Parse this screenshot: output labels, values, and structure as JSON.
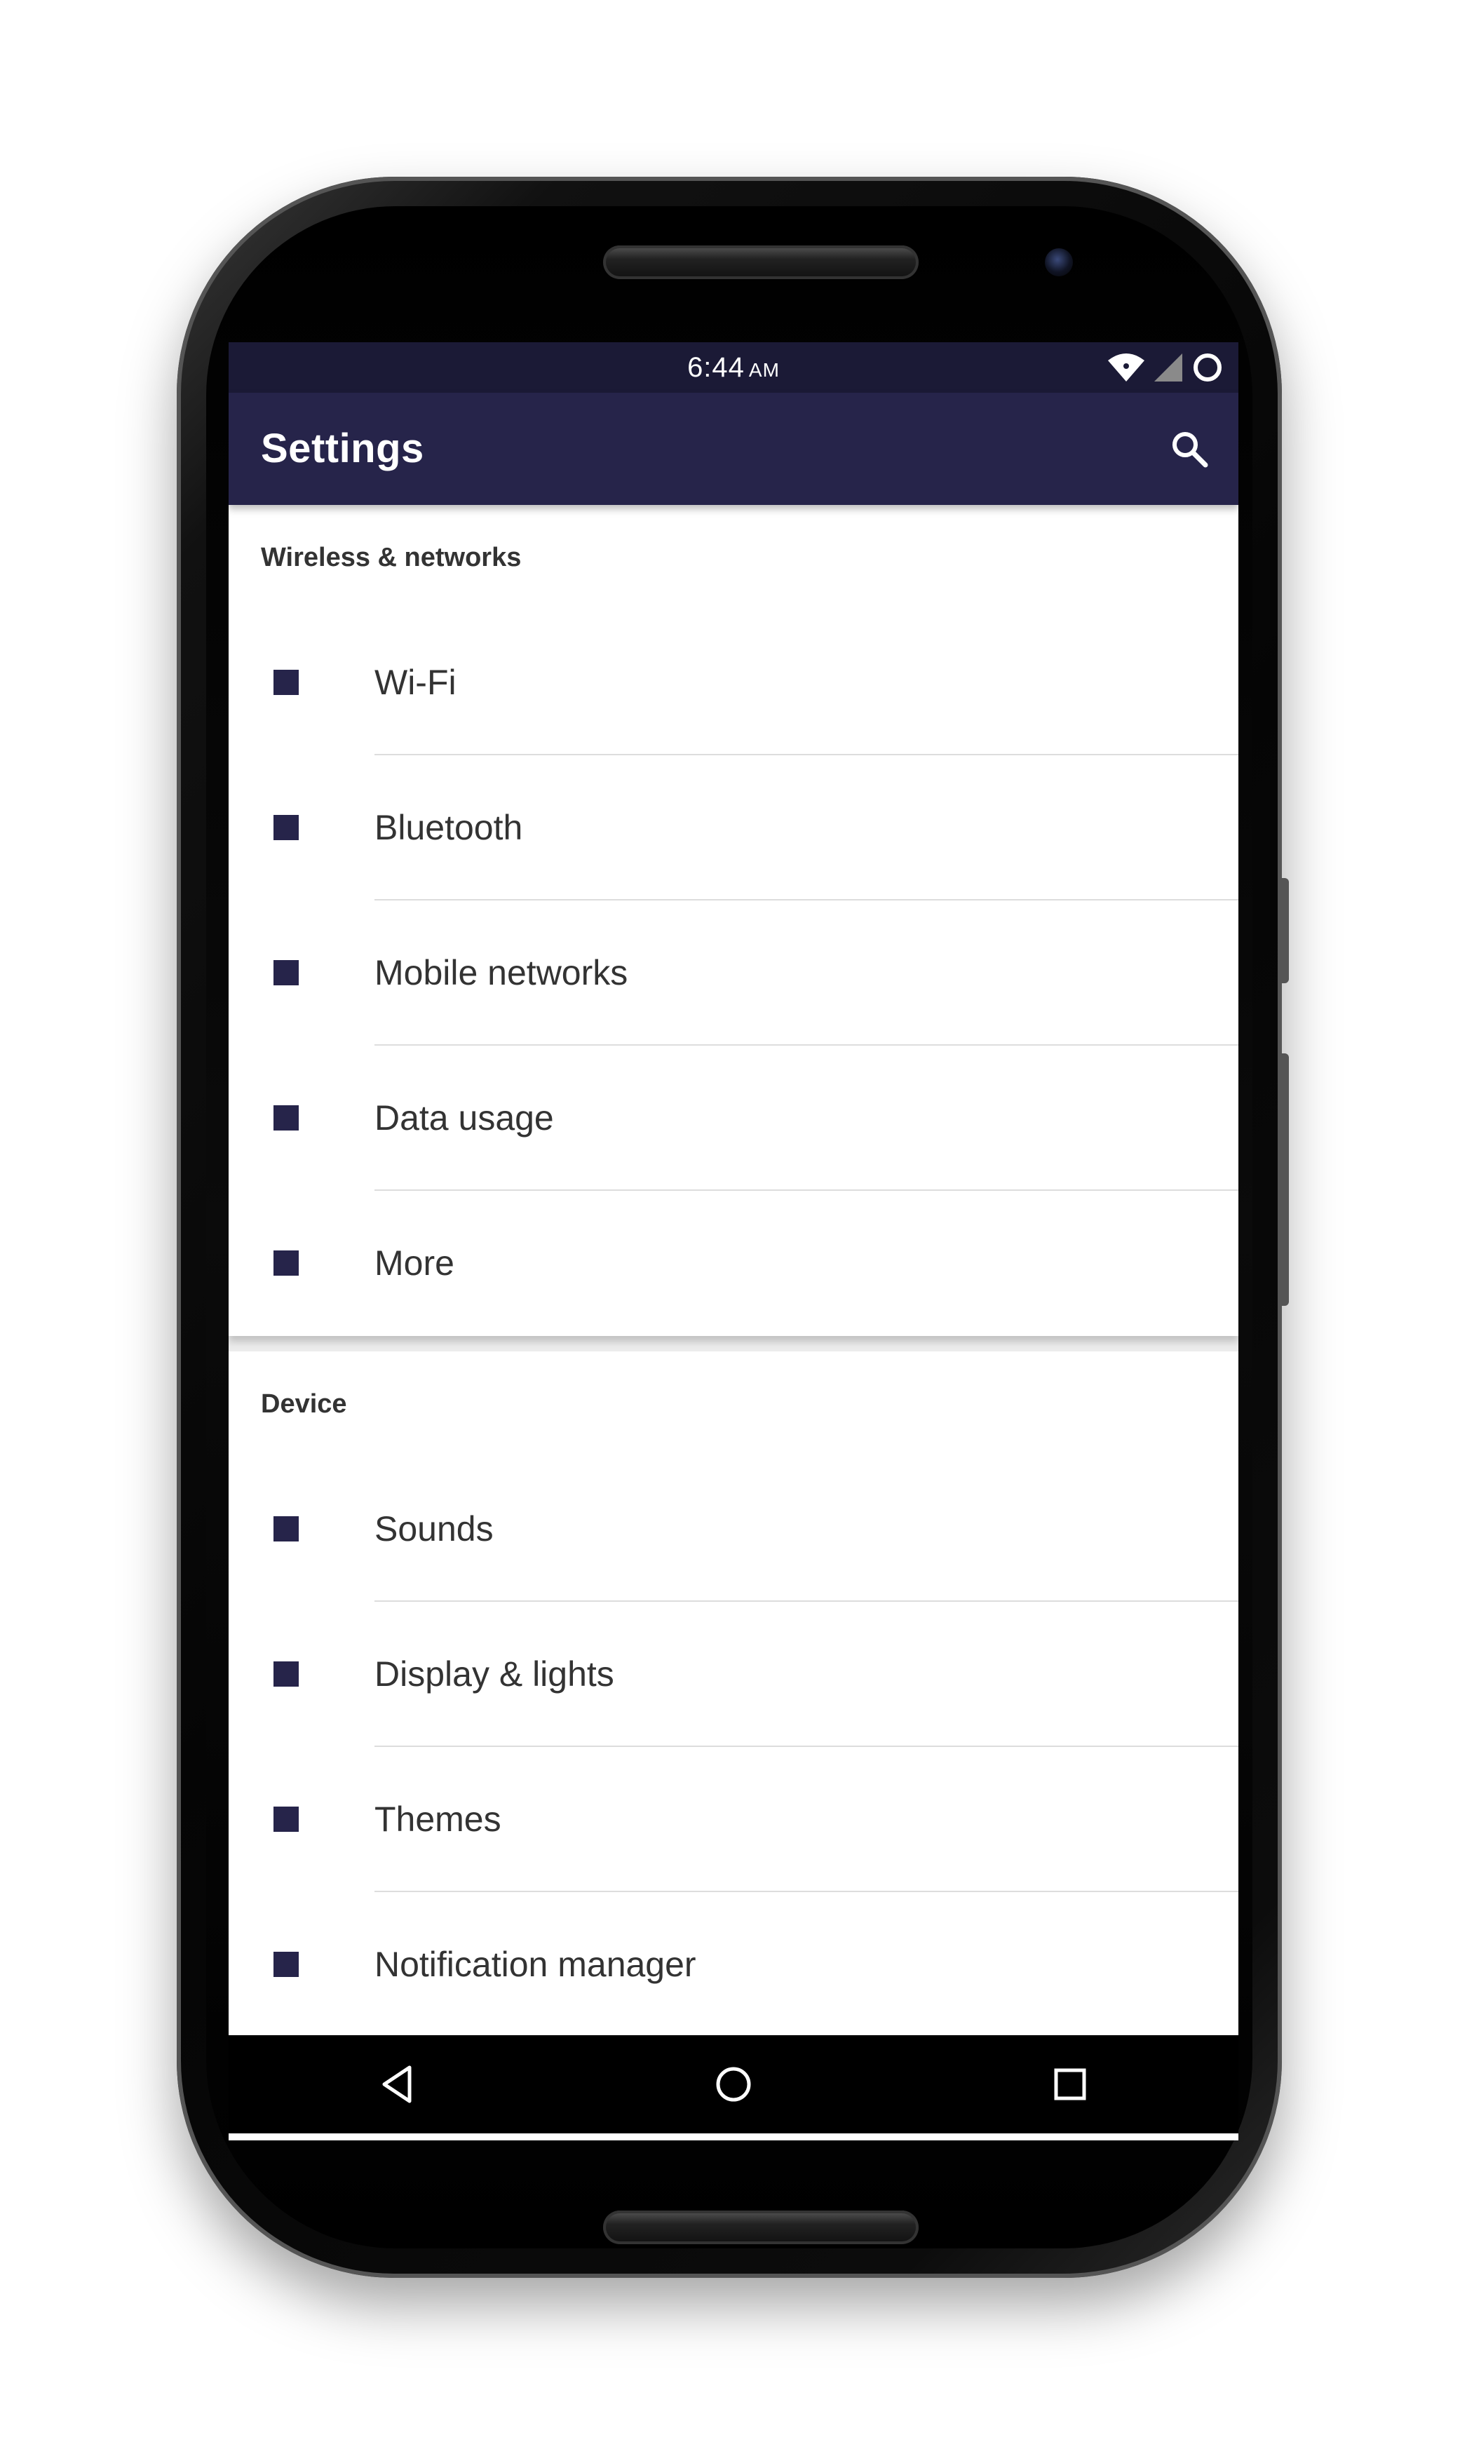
{
  "statusbar": {
    "time": "6:44",
    "ampm": "AM",
    "icons": [
      "wifi-icon",
      "cell-signal-icon",
      "battery-icon"
    ]
  },
  "appbar": {
    "title": "Settings",
    "search_icon": "search-icon"
  },
  "sections": [
    {
      "header": "Wireless & networks",
      "items": [
        "Wi-Fi",
        "Bluetooth",
        "Mobile networks",
        "Data usage",
        "More"
      ]
    },
    {
      "header": "Device",
      "items": [
        "Sounds",
        "Display & lights",
        "Themes",
        "Notification manager"
      ]
    }
  ],
  "navbar": {
    "buttons": [
      "back-icon",
      "home-icon",
      "recents-icon"
    ]
  },
  "colors": {
    "statusbar": "#1b1a36",
    "appbar": "#26244a",
    "icon": "#26244a",
    "text": "#333333"
  }
}
